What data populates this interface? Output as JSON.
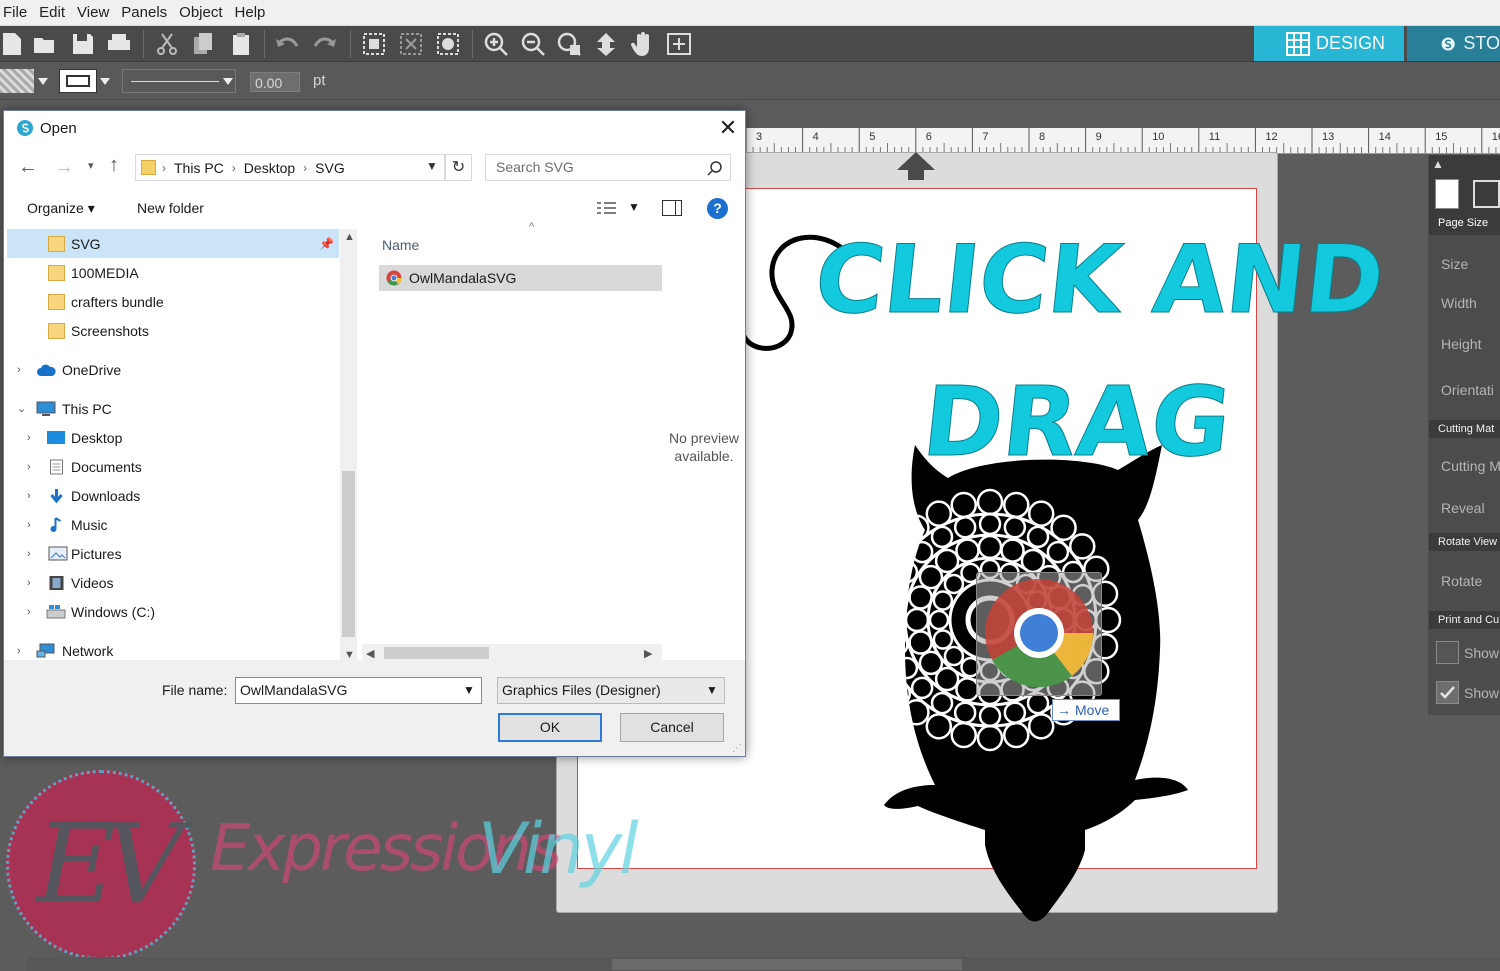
{
  "app": {
    "menu": [
      "File",
      "Edit",
      "View",
      "Panels",
      "Object",
      "Help"
    ],
    "design_tab": "DESIGN",
    "store_tab": "STO",
    "line_width_value": "0.00",
    "line_width_unit": "pt",
    "ruler_numbers": [
      "3",
      "4",
      "5",
      "6",
      "7",
      "8",
      "9",
      "10",
      "11",
      "12",
      "13",
      "14",
      "15",
      "16"
    ],
    "right_panel": {
      "page_size_tab": "Page Size",
      "size": "Size",
      "width": "Width",
      "height": "Height",
      "orientation": "Orientati",
      "cutting_mat_tab": "Cutting Mat",
      "cutting_mat": "Cutting M",
      "reveal": "Reveal",
      "rotate_view_tab": "Rotate View",
      "rotate": "Rotate",
      "print_cut_tab": "Print and Cu",
      "show_1": "Show",
      "show_2": "Show"
    }
  },
  "artwork": {
    "headline_1": "CLICK AND",
    "headline_2": "DRAG",
    "headline_color": "#12c9dd",
    "drag_tooltip": "Move"
  },
  "watermark": {
    "logo_letters": "EV",
    "brand_a": "Expressions",
    "brand_b": "Vinyl"
  },
  "dialog": {
    "title": "Open",
    "breadcrumb": [
      "This PC",
      "Desktop",
      "SVG"
    ],
    "search_placeholder": "Search SVG",
    "organize": "Organize",
    "new_folder": "New folder",
    "column_name": "Name",
    "nav": {
      "quick": [
        "SVG",
        "100MEDIA",
        "crafters bundle",
        "Screenshots"
      ],
      "onedrive": "OneDrive",
      "this_pc": "This PC",
      "pc_items": [
        "Desktop",
        "Documents",
        "Downloads",
        "Music",
        "Pictures",
        "Videos",
        "Windows (C:)"
      ],
      "network": "Network"
    },
    "files": [
      {
        "name": "OwlMandalaSVG",
        "icon": "chrome-icon"
      }
    ],
    "no_preview": "No preview available.",
    "filename_label": "File name:",
    "filename_value": "OwlMandalaSVG",
    "filetype": "Graphics Files (Designer)",
    "ok": "OK",
    "cancel": "Cancel"
  }
}
